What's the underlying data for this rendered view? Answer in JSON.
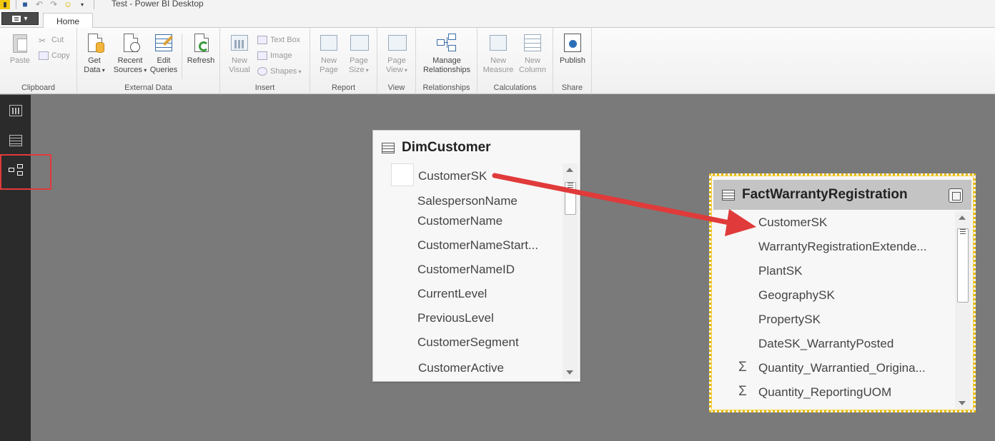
{
  "window": {
    "title": "Test - Power BI Desktop"
  },
  "ribbon": {
    "tabs": [
      {
        "label": "Home"
      }
    ],
    "groups": {
      "clipboard": {
        "label": "Clipboard",
        "paste": "Paste",
        "cut": "Cut",
        "copy": "Copy"
      },
      "external_data": {
        "label": "External Data",
        "get_data": [
          "Get",
          "Data"
        ],
        "recent_sources": [
          "Recent",
          "Sources"
        ],
        "edit_queries": [
          "Edit",
          "Queries"
        ],
        "refresh": "Refresh"
      },
      "insert": {
        "label": "Insert",
        "new_visual": [
          "New",
          "Visual"
        ],
        "text_box": "Text Box",
        "image": "Image",
        "shapes": "Shapes"
      },
      "report": {
        "label": "Report",
        "new_page": [
          "New",
          "Page"
        ],
        "page_size": [
          "Page",
          "Size"
        ]
      },
      "view": {
        "label": "View",
        "page_view": [
          "Page",
          "View"
        ]
      },
      "relationships": {
        "label": "Relationships",
        "manage": [
          "Manage",
          "Relationships"
        ]
      },
      "calculations": {
        "label": "Calculations",
        "new_measure": [
          "New",
          "Measure"
        ],
        "new_column": [
          "New",
          "Column"
        ]
      },
      "share": {
        "label": "Share",
        "publish": "Publish"
      }
    }
  },
  "tables": {
    "dim_customer": {
      "title": "DimCustomer",
      "fields": [
        "CustomerSK",
        "SalespersonName",
        "CustomerName",
        "CustomerNameStart...",
        "CustomerNameID",
        "CurrentLevel",
        "PreviousLevel",
        "CustomerSegment",
        "CustomerActive"
      ]
    },
    "fact_warranty": {
      "title": "FactWarrantyRegistration",
      "fields": [
        "CustomerSK",
        "WarrantyRegistrationExtende...",
        "PlantSK",
        "GeographySK",
        "PropertySK",
        "DateSK_WarrantyPosted",
        "Quantity_Warrantied_Origina...",
        "Quantity_ReportingUOM"
      ]
    }
  },
  "colors": {
    "highlight": "#e03a3a",
    "selection_border": "#e4b800",
    "app_yellow": "#f2c811"
  }
}
